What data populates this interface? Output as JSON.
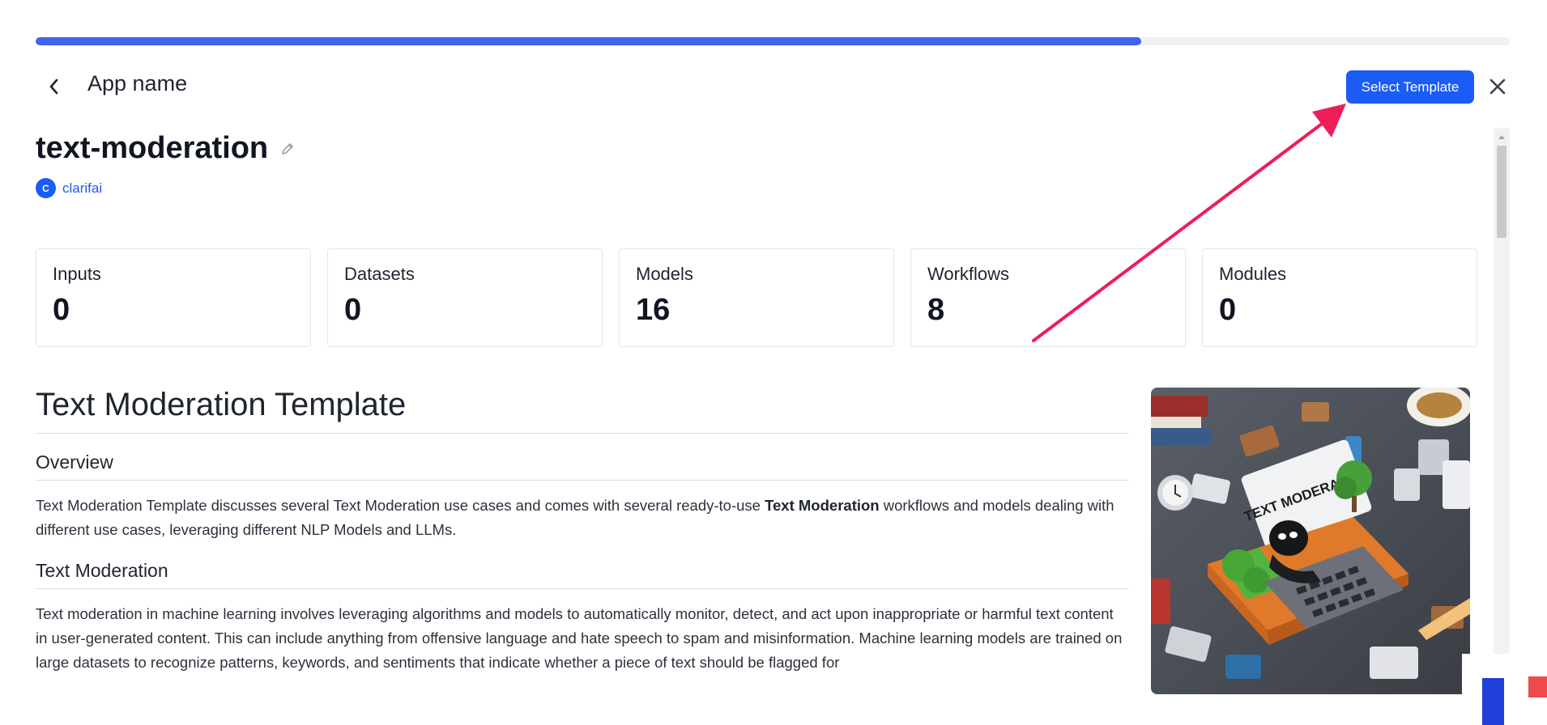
{
  "progress": {
    "fraction": 0.75
  },
  "header": {
    "back_icon": "chevron-left-icon",
    "app_name": "App name",
    "select_template_label": "Select Template",
    "close_icon": "close-icon"
  },
  "app": {
    "title": "text-moderation",
    "edit_icon": "pencil-icon",
    "owner_initial": "C",
    "owner_name": "clarifai"
  },
  "stats": [
    {
      "label": "Inputs",
      "value": "0"
    },
    {
      "label": "Datasets",
      "value": "0"
    },
    {
      "label": "Models",
      "value": "16"
    },
    {
      "label": "Workflows",
      "value": "8"
    },
    {
      "label": "Modules",
      "value": "0"
    }
  ],
  "readme": {
    "title": "Text Moderation Template",
    "overview_heading": "Overview",
    "overview_before": "Text Moderation Template discusses several Text Moderation use cases and comes with several ready-to-use ",
    "overview_bold": "Text Moderation",
    "overview_after": " workflows and models dealing with different use cases, leveraging different NLP Models and LLMs.",
    "section_heading": "Text Moderation",
    "section_text": "Text moderation in machine learning involves leveraging algorithms and models to automatically monitor, detect, and act upon inappropriate or harmful text content in user-generated content. This can include anything from offensive language and hate speech to spam and misinformation. Machine learning models are trained on large datasets to recognize patterns, keywords, and sentiments that indicate whether a piece of text should be flagged for"
  },
  "thumbnail": {
    "sign_text": "TEXT MODERATION"
  },
  "colors": {
    "accent": "#1a5cf5",
    "progress": "#3e63ec",
    "annotation_arrow": "#ee1d5a"
  }
}
